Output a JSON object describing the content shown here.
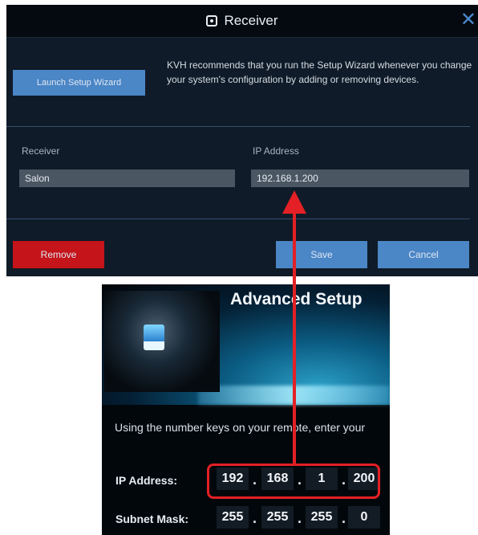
{
  "dialog": {
    "title": "Receiver",
    "close_icon": "close-icon",
    "title_icon": "receiver-icon",
    "wizard_button": "Launch Setup Wizard",
    "info_text": "KVH recommends that you run the Setup Wizard whenever you change your system's configuration by adding or removing devices.",
    "receiver_label": "Receiver",
    "receiver_value": "Salon",
    "ip_label": "IP Address",
    "ip_value": "192.168.1.200",
    "remove_button": "Remove",
    "save_button": "Save",
    "cancel_button": "Cancel"
  },
  "tv_screen": {
    "title": "Advanced Setup",
    "instructions": "Using the number keys on your remote, enter your",
    "ip_label": "IP Address:",
    "ip_octets": [
      "192",
      "168",
      "1",
      "200"
    ],
    "subnet_label": "Subnet Mask:",
    "subnet_octets": [
      "255",
      "255",
      "255",
      "0"
    ]
  },
  "colors": {
    "accent_blue": "#4b86c6",
    "danger_red": "#c5141a",
    "arrow_red": "#e32025",
    "panel_bg": "#0f1b28"
  }
}
